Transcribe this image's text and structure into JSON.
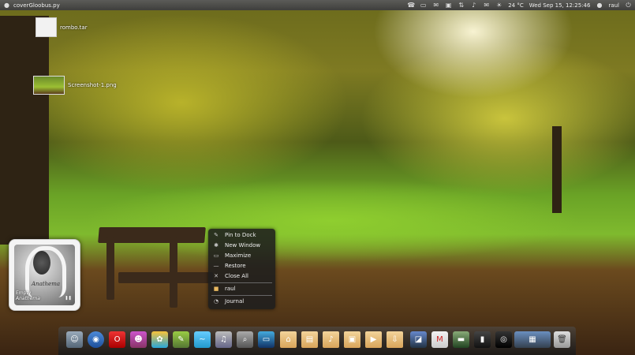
{
  "panel": {
    "app_title": "coverGloobus.py",
    "temperature": "24 °C",
    "datetime": "Wed Sep 15, 12:25:46",
    "user": "raul"
  },
  "desktop": {
    "icons": [
      {
        "label": "rombo.tar"
      },
      {
        "label": "Screenshot-1.png"
      }
    ]
  },
  "player": {
    "cover_logo": "Anathema",
    "track_line1": "Empty",
    "track_line2": "Anathema"
  },
  "context_menu": {
    "items": [
      "Pin to Dock",
      "New Window",
      "Maximize",
      "Restore",
      "Close All",
      "raul",
      "Journal"
    ]
  },
  "dock": {
    "items": [
      "finder-icon",
      "web-browser-icon",
      "opera-icon",
      "empathy-icon",
      "photo-icon",
      "notes-icon",
      "twitter-icon",
      "music-icon",
      "search-icon",
      "monitor-icon",
      "home-folder",
      "documents-folder",
      "music-folder",
      "pictures-folder",
      "videos-folder",
      "downloads-folder",
      "image-app-icon",
      "gmail-icon",
      "terminal-icon",
      "system-monitor-icon",
      "camera-icon",
      "workspace-switcher",
      "trash-icon"
    ]
  }
}
